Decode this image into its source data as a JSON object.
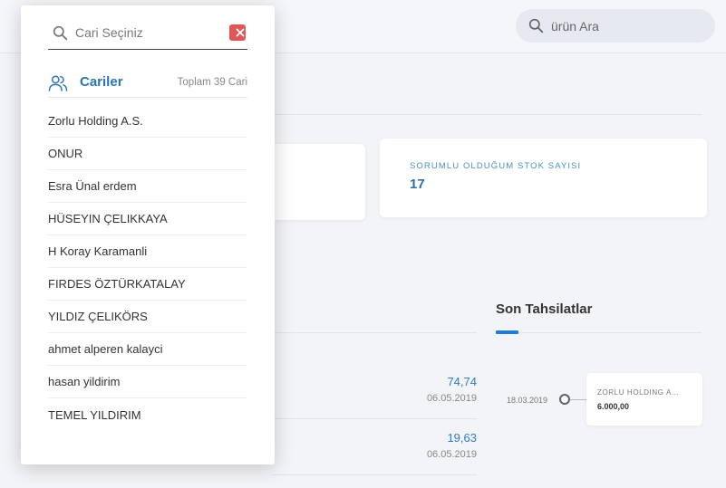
{
  "header": {
    "search_placeholder": "ürün Ara"
  },
  "stats": {
    "stock_label": "SORUMLU OLDUĞUM STOK SAYISI",
    "stock_value": "17"
  },
  "payments": [
    {
      "amount": "74,74",
      "date": "06.05.2019"
    },
    {
      "amount": "19,63",
      "date": "06.05.2019"
    }
  ],
  "collections": {
    "title": "Son Tahsilatlar",
    "items": [
      {
        "date": "18.03.2019",
        "name": "ZORLU HOLDING A...",
        "amount": "6.000,00"
      }
    ]
  },
  "popup": {
    "search_placeholder": "Cari Seçiniz",
    "title": "Cariler",
    "total": "Toplam 39 Cari",
    "items": [
      "Zorlu Holding A.S.",
      "ONUR",
      "Esra Ünal erdem",
      "HÜSEYIN ÇELIKKAYA",
      "H Koray Karamanli",
      "FIRDES ÖZTÜRKATALAY",
      "YILDIZ ÇELIKÖRS",
      "ahmet alperen kalayci",
      "hasan yildirim",
      "TEMEL YILDIRIM"
    ]
  },
  "colors": {
    "accent": "#2a74b8",
    "close": "#e05757"
  },
  "icons": {
    "search": "search-icon",
    "close": "close-icon",
    "users": "users-icon"
  }
}
